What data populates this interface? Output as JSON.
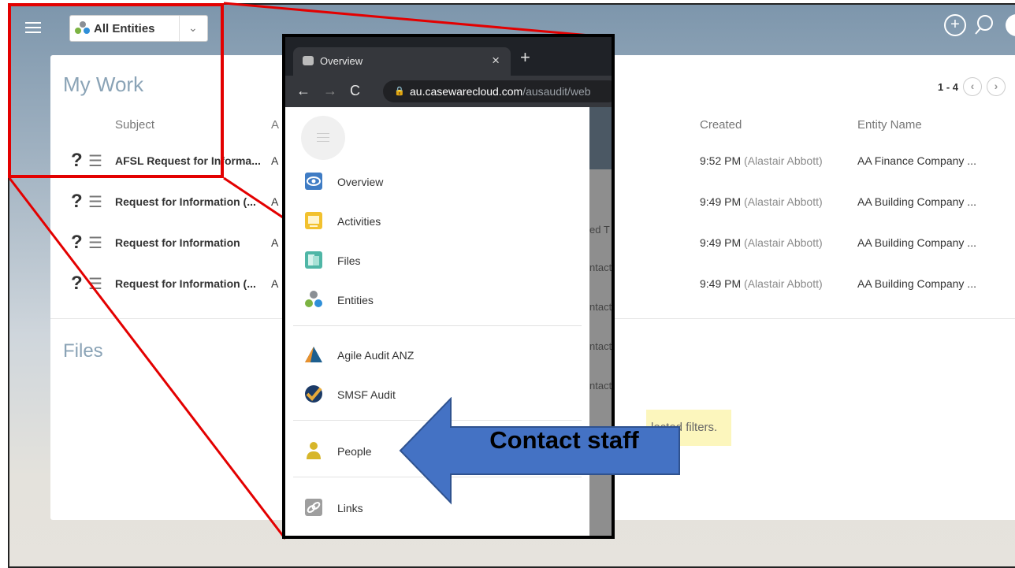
{
  "header": {
    "entity_selector": "All Entities",
    "chevron": "⌄"
  },
  "mywork": {
    "title": "My Work",
    "pager": "1 - 4",
    "columns": {
      "subject": "Subject",
      "a": "A",
      "created": "Created",
      "entity": "Entity Name"
    },
    "rows": [
      {
        "subject": "AFSL Request for Informa...",
        "a": "A",
        "created_time": "9:52 PM",
        "created_by": "(Alastair Abbott)",
        "entity": "AA Finance Company ..."
      },
      {
        "subject": "Request for Information (...",
        "a": "A",
        "created_time": "9:49 PM",
        "created_by": "(Alastair Abbott)",
        "entity": "AA Building Company ..."
      },
      {
        "subject": "Request for Information",
        "a": "A",
        "created_time": "9:49 PM",
        "created_by": "(Alastair Abbott)",
        "entity": "AA Building Company ..."
      },
      {
        "subject": "Request for Information (...",
        "a": "A",
        "created_time": "9:49 PM",
        "created_by": "(Alastair Abbott)",
        "entity": "AA Building Company ..."
      }
    ]
  },
  "files": {
    "title": "Files",
    "filter_message": "lected filters."
  },
  "background_peek": [
    "ed T",
    "ntact",
    "ntact",
    "ntact",
    "ntact"
  ],
  "browser": {
    "tab_title": "Overview",
    "url_host": "au.casewarecloud.com",
    "url_rest": "/ausaudit/web",
    "menu": [
      {
        "label": "Overview",
        "icon": "overview-icon"
      },
      {
        "label": "Activities",
        "icon": "activities-icon"
      },
      {
        "label": "Files",
        "icon": "files-icon"
      },
      {
        "label": "Entities",
        "icon": "entities-icon"
      },
      {
        "label": "Agile Audit ANZ",
        "icon": "agile-audit-icon"
      },
      {
        "label": "SMSF Audit",
        "icon": "smsf-audit-icon"
      },
      {
        "label": "People",
        "icon": "people-icon"
      },
      {
        "label": "Links",
        "icon": "links-icon"
      }
    ]
  },
  "callout": {
    "text": "Contact staff",
    "color": "#4472c4"
  }
}
